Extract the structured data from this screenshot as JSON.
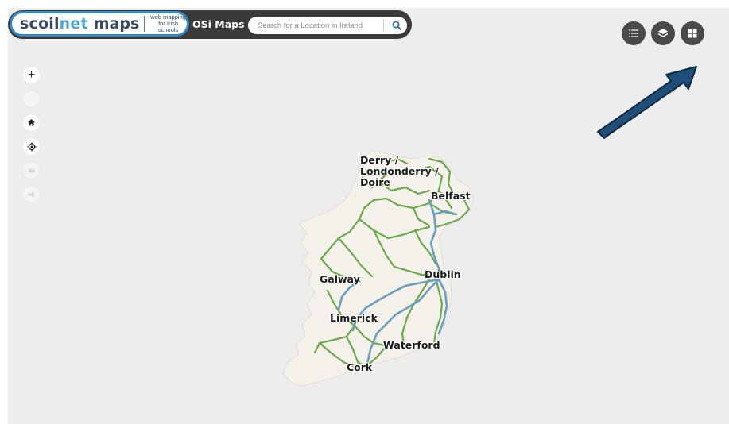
{
  "header": {
    "brand_word_scoil": "scoil",
    "brand_word_net": "net",
    "brand_word_maps": "maps",
    "brand_tagline_line1": "web mapping",
    "brand_tagline_line2": "for Irish schools",
    "map_source_label": "OSi Maps"
  },
  "search": {
    "placeholder": "Search for a Location in Ireland",
    "icon": "search-icon"
  },
  "toolbar": {
    "buttons": [
      {
        "icon": "list-icon"
      },
      {
        "icon": "layers-icon"
      },
      {
        "icon": "grid-icon"
      }
    ]
  },
  "map_controls": {
    "zoom_in_label": "+",
    "home_icon": "home-icon",
    "locate_icon": "locate-icon",
    "back_icon": "arrow-left-icon",
    "forward_icon": "arrow-right-icon"
  },
  "map": {
    "labels": {
      "derry": "Derry /\nLondonderry /\nDoire",
      "belfast": "Belfast",
      "galway": "Galway",
      "dublin": "Dublin",
      "limerick": "Limerick",
      "waterford": "Waterford",
      "cork": "Cork"
    }
  },
  "annotation": {
    "arrow_color": "#1f4e79",
    "pointing_to": "grid-icon"
  },
  "colors": {
    "brand_blue": "#2f89c9",
    "header_dark": "#3a3a3a",
    "rail_green": "#6aaa4a",
    "motorway_blue": "#6b9dc0",
    "map_background": "#ededed"
  }
}
